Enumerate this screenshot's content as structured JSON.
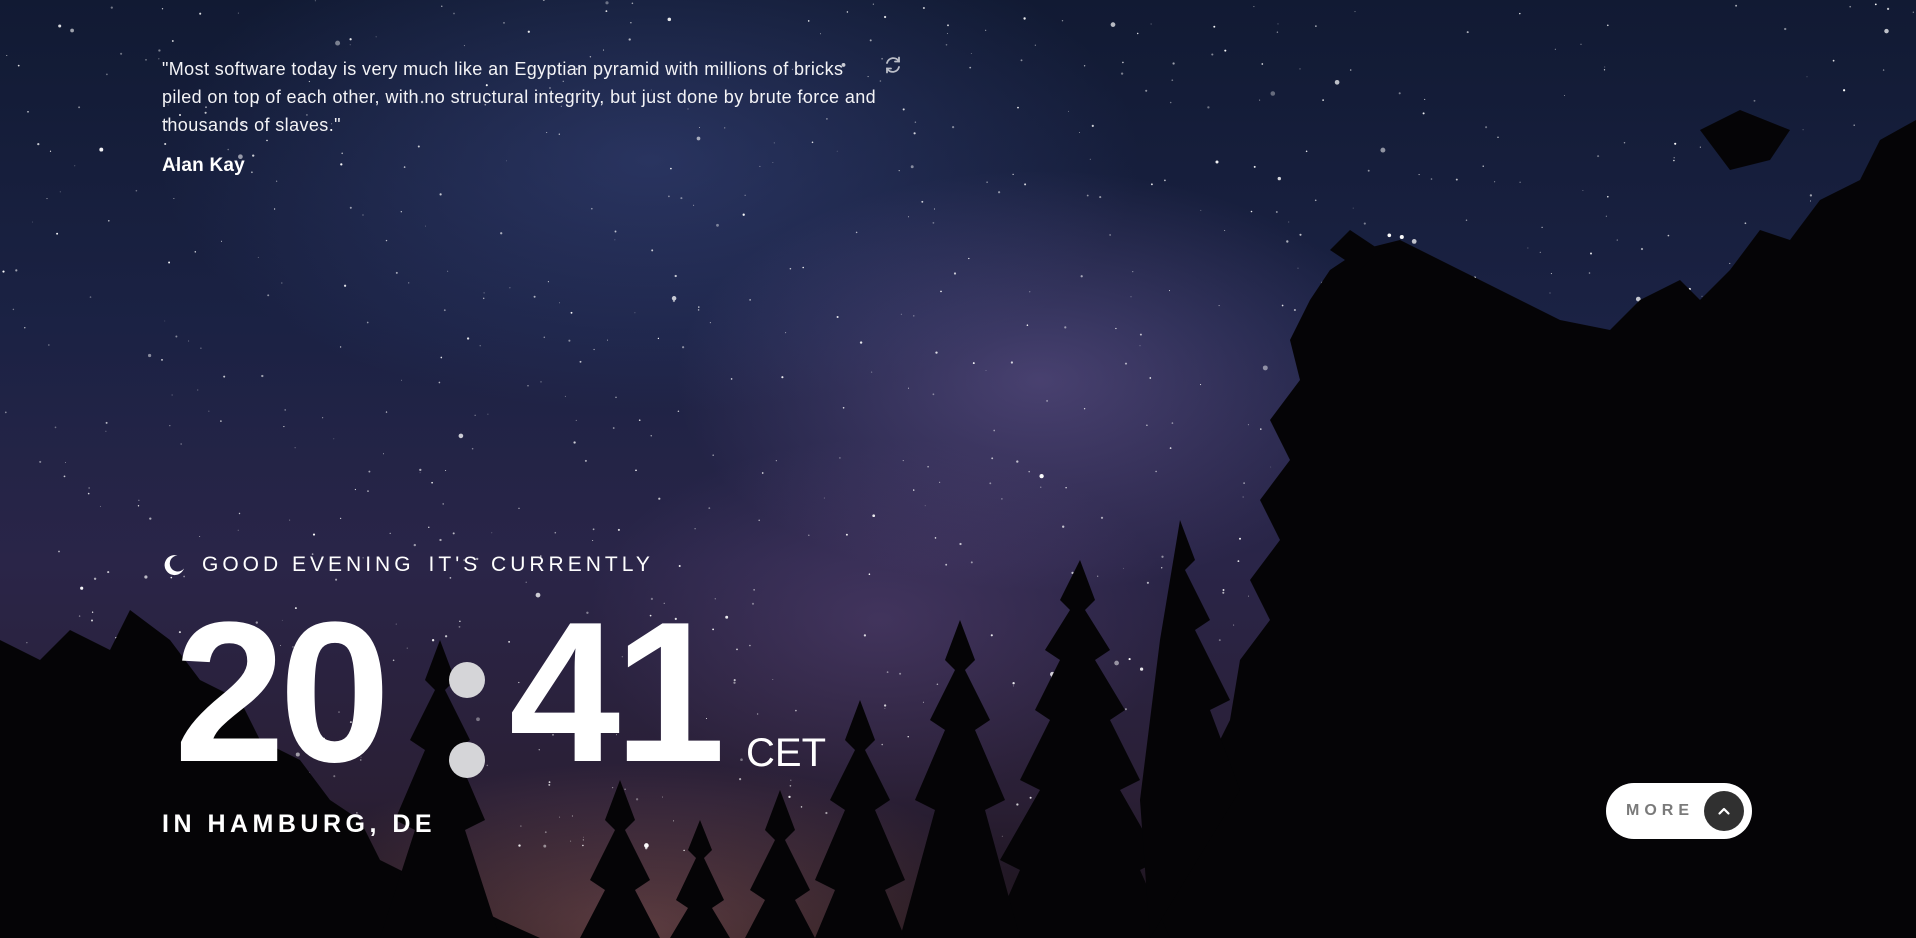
{
  "quote": {
    "text": "\"Most software today is very much like an Egyptian pyramid with millions of bricks piled on top of each other, with no structural integrity, but just done by brute force and thousands of slaves.\"",
    "author": "Alan Kay",
    "refresh_icon": "refresh-icon"
  },
  "greeting": {
    "icon": "moon-icon",
    "salutation": "GOOD EVENING",
    "suffix": "IT'S CURRENTLY"
  },
  "clock": {
    "hours": "20",
    "minutes": "41",
    "timezone": "CET",
    "location": "IN HAMBURG, DE"
  },
  "more_button": {
    "label": "MORE",
    "icon": "chevron-up-icon"
  },
  "colors": {
    "text": "#ffffff",
    "button_bg": "#ffffff",
    "button_label": "#7a7a7a",
    "chevron_bg": "#303030",
    "colon": "#d5d5d8"
  }
}
